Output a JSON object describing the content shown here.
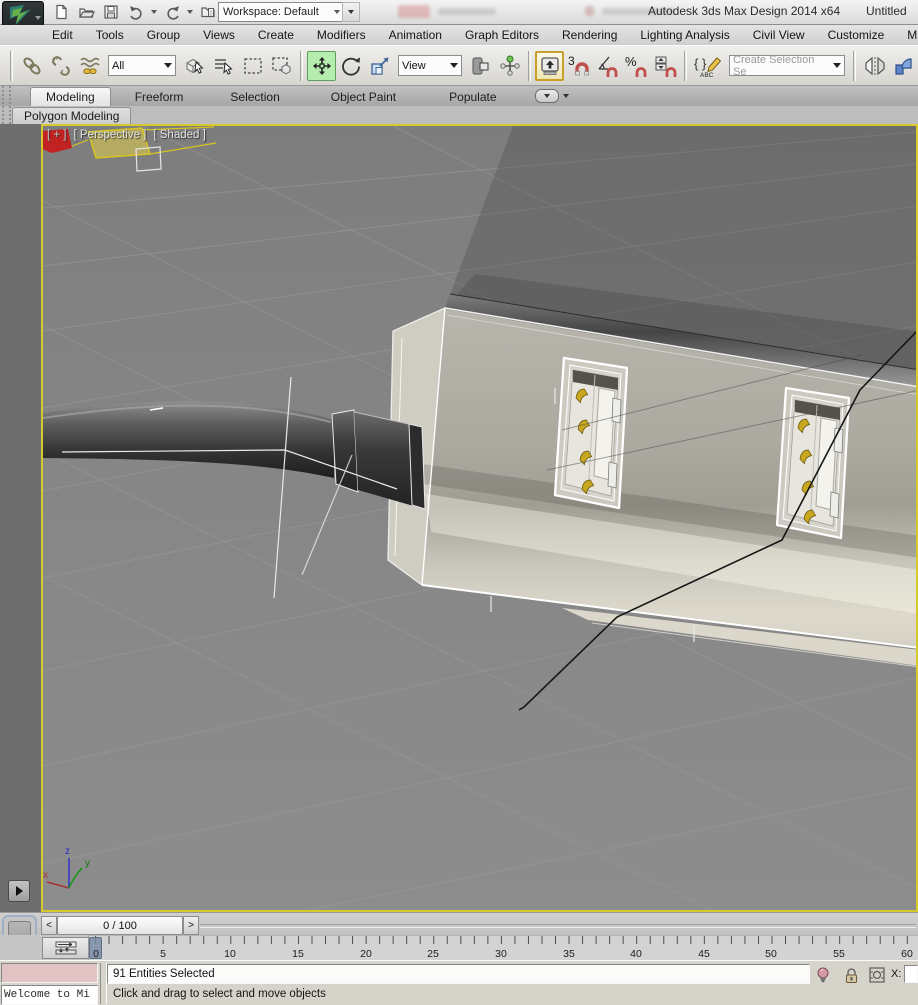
{
  "window": {
    "title": "Autodesk 3ds Max Design 2014 x64",
    "document": "Untitled",
    "workspace": "Workspace: Default",
    "logo": "MXD"
  },
  "menu": {
    "items": [
      "Edit",
      "Tools",
      "Group",
      "Views",
      "Create",
      "Modifiers",
      "Animation",
      "Graph Editors",
      "Rendering",
      "Lighting Analysis",
      "Civil View",
      "Customize",
      "M"
    ]
  },
  "toolbar": {
    "selection_filter": "All",
    "coord_system": "View",
    "named_selection": "Create Selection Se",
    "snap3": "3",
    "percent": "%",
    "abc_label": "ABC",
    "icons": [
      "select-and-link",
      "unlink-selection",
      "bind-to-space-warp",
      "select-object",
      "select-by-name",
      "rectangular-selection-region",
      "window-crossing",
      "select-and-move",
      "select-and-rotate",
      "select-and-scale",
      "use-pivot-point-center",
      "select-and-manipulate",
      "keyboard-shortcut-override",
      "snap-toggle-3d",
      "angle-snap",
      "percent-snap",
      "spinner-snap",
      "edit-named-selection-sets",
      "mirror",
      "align"
    ]
  },
  "ribbon": {
    "tabs": [
      "Modeling",
      "Freeform",
      "Selection",
      "Object Paint",
      "Populate"
    ],
    "active_tab": "Modeling",
    "panel_tab": "Polygon Modeling"
  },
  "viewport": {
    "nav_label": "[ + ]",
    "pov_label": "[ Perspective ]",
    "shading_label": "[ Shaded ]",
    "axis_x": "x",
    "axis_y": "y",
    "axis_z": "z",
    "border_color": "#d5c92d",
    "scene": "USB hub with cable, two USB ports, selected object highlighted yellow"
  },
  "timeline": {
    "slider": "0 / 100",
    "prev": "<",
    "next": ">",
    "ruler": [
      "0",
      "5",
      "10",
      "15",
      "20",
      "25",
      "30",
      "35",
      "40",
      "45",
      "50",
      "55",
      "60"
    ]
  },
  "status": {
    "listener": "Welcome to Mi",
    "selection": "91 Entities Selected",
    "prompt": "Click and drag to select and move objects",
    "x_label": "X:"
  },
  "colors": {
    "active_tool_green": "#b5edae",
    "override_gold": "#c9a02c",
    "usb_pin_gold": "#c7a81e",
    "selection_yellow": "#e8d23c"
  }
}
